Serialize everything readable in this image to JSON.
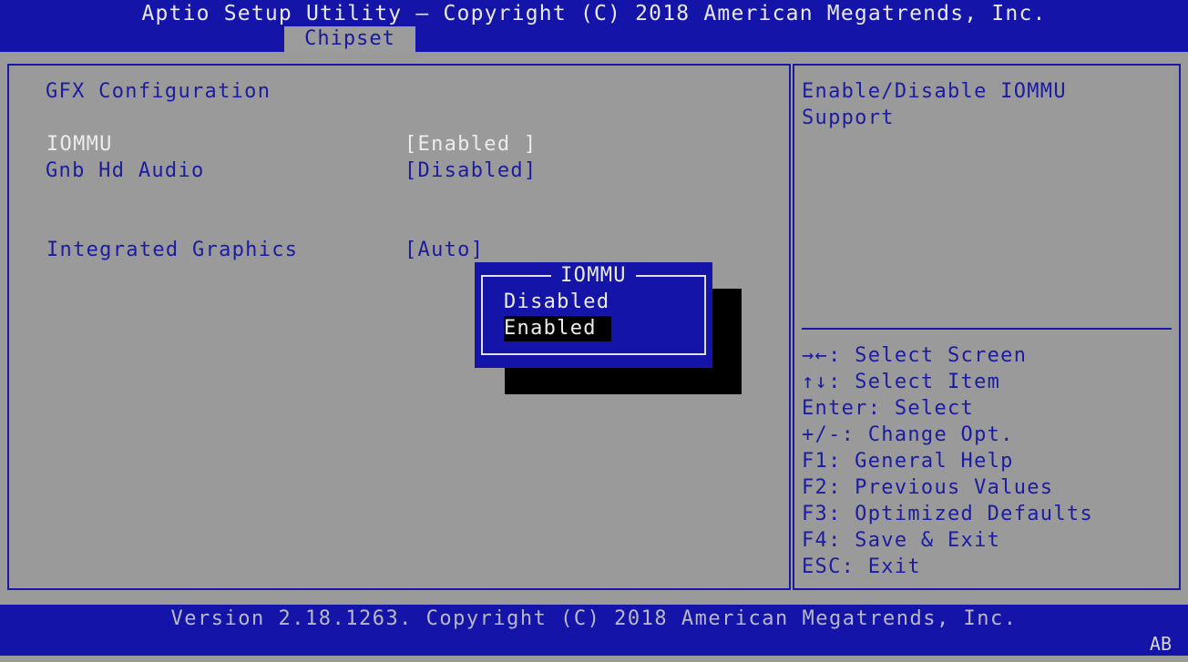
{
  "header": {
    "title": "Aptio Setup Utility – Copyright (C) 2018 American Megatrends, Inc.",
    "active_tab": "Chipset"
  },
  "main": {
    "section_title": "GFX Configuration",
    "settings": [
      {
        "label": "IOMMU",
        "value": "[Enabled ]",
        "selected": true
      },
      {
        "label": "Gnb Hd Audio",
        "value": "[Disabled]",
        "selected": false
      },
      {
        "label": "Integrated Graphics",
        "value": "[Auto]",
        "selected": false
      }
    ]
  },
  "popup": {
    "title": "IOMMU",
    "options": [
      {
        "label": "Disabled",
        "highlighted": false
      },
      {
        "label": "Enabled",
        "highlighted": true
      }
    ]
  },
  "help": {
    "description_line1": "Enable/Disable IOMMU",
    "description_line2": "Support",
    "keys": [
      "→←: Select Screen",
      "↑↓: Select Item",
      "Enter: Select",
      "+/-: Change Opt.",
      "F1: General Help",
      "F2: Previous Values",
      "F3: Optimized Defaults",
      "F4: Save & Exit",
      "ESC: Exit"
    ]
  },
  "footer": {
    "version": "Version 2.18.1263. Copyright (C) 2018 American Megatrends, Inc.",
    "badge": "AB"
  },
  "colors": {
    "bar_blue": "#1414a8",
    "panel_gray": "#9a9a9a",
    "text_blue": "#1c1ca0",
    "text_white": "#ececec"
  }
}
